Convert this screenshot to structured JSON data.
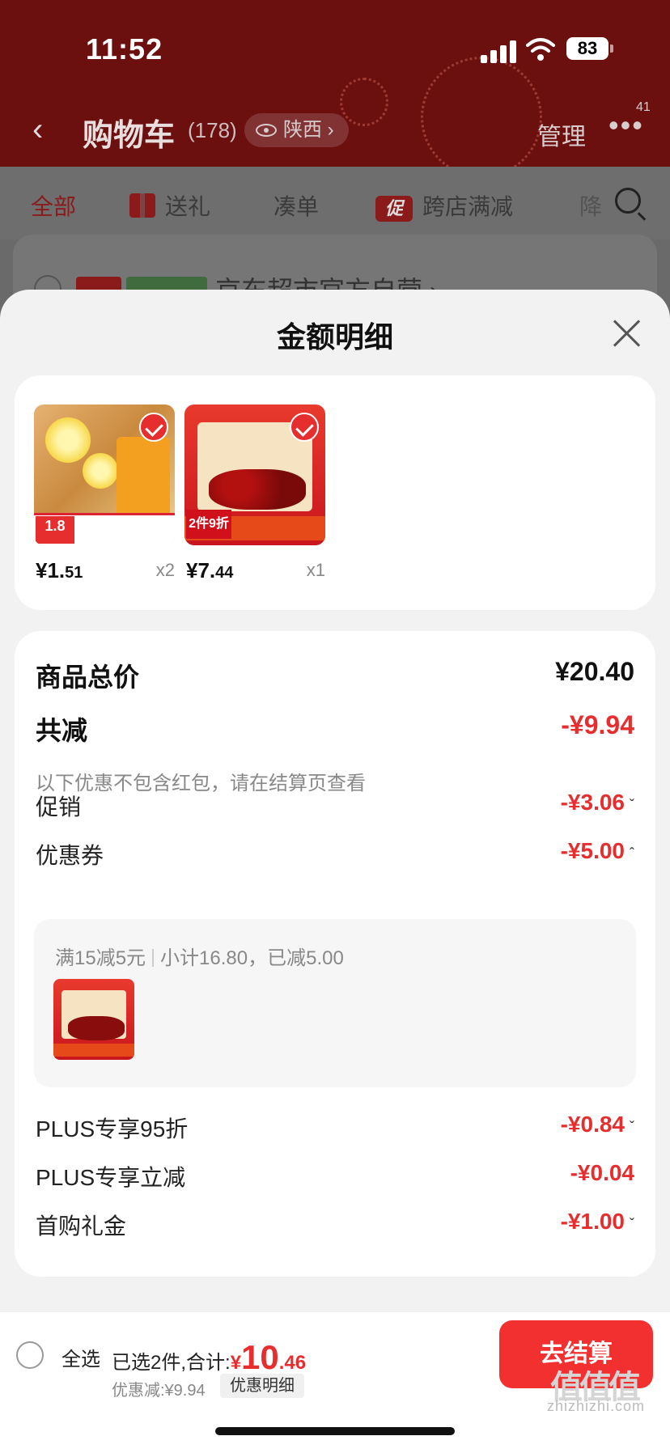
{
  "status_bar": {
    "time": "11:52",
    "battery": "83"
  },
  "navbar": {
    "title": "购物车",
    "count": "(178)",
    "location": "陕西",
    "location_chevron": "›",
    "manage": "管理",
    "more_badge": "41"
  },
  "tabs": {
    "all": "全部",
    "gift": "送礼",
    "bundle": "凑单",
    "promo_badge": "促",
    "cross_store": "跨店满减",
    "tail": "降"
  },
  "store": {
    "name": "京东超市官方自营 ›"
  },
  "sheet": {
    "title": "金额明细",
    "products": [
      {
        "price_int": "¥1.",
        "price_dec": "51",
        "qty": "x2",
        "thumb_tag": "1.8"
      },
      {
        "price_int": "¥7.",
        "price_dec": "44",
        "qty": "x1",
        "thumb_tag": "2件9折"
      }
    ],
    "details": {
      "total_label": "商品总价",
      "total_value": "¥20.40",
      "reduce_label": "共减",
      "reduce_value": "-¥9.94",
      "note": "以下优惠不包含红包，请在结算页查看",
      "promo_label": "促销",
      "promo_value": "-¥3.06",
      "coupon_label": "优惠券",
      "coupon_value": "-¥5.00",
      "coupon_rule": "满15减5元",
      "coupon_info": "小计16.80，已减5.00",
      "plus95_label": "PLUS专享95折",
      "plus95_value": "-¥0.84",
      "plus_reduce_label": "PLUS专享立减",
      "plus_reduce_value": "-¥0.04",
      "first_gift_label": "首购礼金",
      "first_gift_value": "-¥1.00"
    }
  },
  "bottom_bar": {
    "select_all": "全选",
    "selected": "已选2件,合计:",
    "currency": "¥",
    "total_int": "10",
    "total_dec": ".46",
    "saved": "优惠减:¥9.94",
    "detail_button": "优惠明细",
    "checkout": "去结算"
  },
  "watermark": {
    "site": "zhizhizhi.com",
    "mark": "值值值"
  },
  "colors": {
    "accent": "#e62e2e",
    "header_bg": "#6b0f0f",
    "checkout": "#f23030"
  }
}
